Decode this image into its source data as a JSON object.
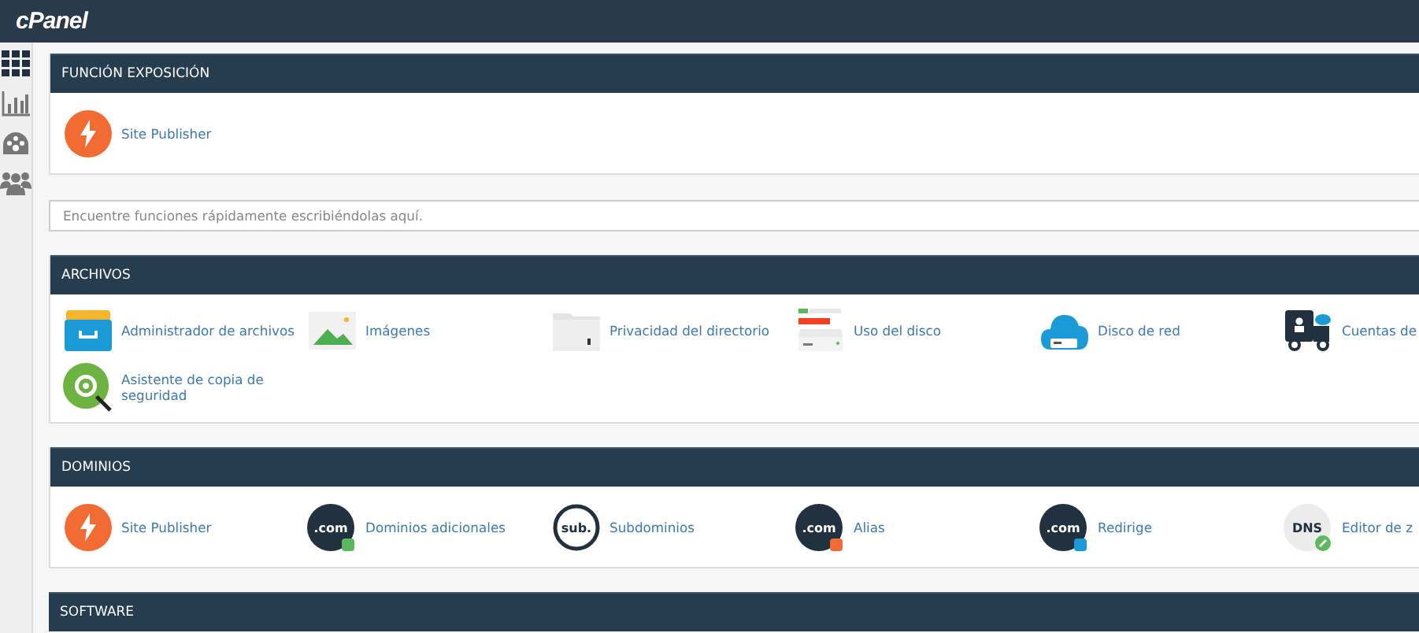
{
  "topbar": {
    "logo": "cPanel"
  },
  "sidebar": {
    "items": [
      {
        "kind": "grid",
        "selected": true
      },
      {
        "kind": "stats",
        "selected": false
      },
      {
        "kind": "palette",
        "selected": false
      },
      {
        "kind": "users",
        "selected": false
      }
    ]
  },
  "search": {
    "placeholder": "Encuentre funciones rápidamente escribiéndolas aquí."
  },
  "sections": [
    {
      "title": "FUNCIÓN EXPOSICIÓN",
      "items": [
        {
          "kind": "bolt",
          "label": "Site Publisher"
        }
      ]
    },
    {
      "kind": "search"
    },
    {
      "title": "ARCHIVOS",
      "items": [
        {
          "kind": "filebox",
          "label": "Administrador de archivos"
        },
        {
          "kind": "image",
          "label": "Imágenes"
        },
        {
          "kind": "folder",
          "label": "Privacidad del directorio"
        },
        {
          "kind": "disk",
          "label": "Uso del disco"
        },
        {
          "kind": "cloud",
          "label": "Disco de red"
        },
        {
          "kind": "truck",
          "label": "Cuentas de"
        },
        {
          "kind": "backup",
          "label": "Asistente de copia de seguridad"
        }
      ]
    },
    {
      "title": "DOMINIOS",
      "items": [
        {
          "kind": "bolt",
          "label": "Site Publisher"
        },
        {
          "kind": "domain",
          "icon_text": ".com",
          "color": "#5cb85c",
          "label": "Dominios adicionales"
        },
        {
          "kind": "ring",
          "icon_text": "sub.",
          "label": "Subdominios"
        },
        {
          "kind": "domain",
          "icon_text": ".com",
          "color": "#f26b32",
          "label": "Alias"
        },
        {
          "kind": "domain",
          "icon_text": ".com",
          "color": "#1a9ad6",
          "label": "Redirige"
        },
        {
          "kind": "dns",
          "icon_text": "DNS",
          "color": "#5cb85c",
          "label": "Editor de z"
        }
      ]
    },
    {
      "title": "SOFTWARE"
    }
  ]
}
